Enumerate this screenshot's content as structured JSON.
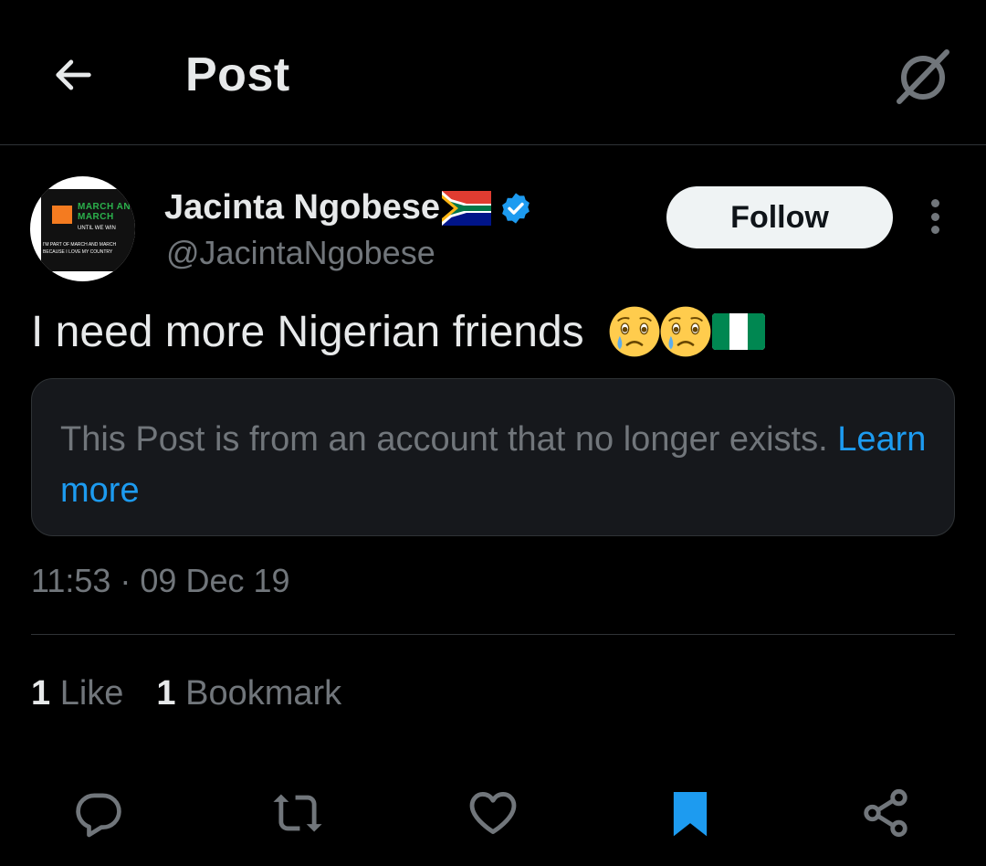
{
  "header": {
    "title": "Post",
    "back_icon": "arrow-left-icon",
    "grok_icon": "grok-icon"
  },
  "author": {
    "display_name": "Jacinta Ngobese",
    "flag_icon": "south-africa-flag-icon",
    "verified_icon": "verified-badge-icon",
    "handle": "@JacintaNgobese",
    "avatar": {
      "line1": "MARCH AND MARCH",
      "line2": "UNTIL WE WIN",
      "line3": "I'M PART OF MARCH AND MARCH",
      "line4": "BECAUSE I LOVE MY COUNTRY"
    }
  },
  "follow_label": "Follow",
  "more_icon": "more-vertical-icon",
  "post": {
    "text": "I need more Nigerian friends",
    "emojis": [
      "crying-face-emoji",
      "crying-face-emoji",
      "nigeria-flag-emoji"
    ]
  },
  "notice": {
    "text": "This Post is from an account that no longer exists.",
    "link": "Learn more"
  },
  "timestamp": "11:53 · 09 Dec 19",
  "stats": {
    "likes_count": "1",
    "likes_label": "Like",
    "bookmarks_count": "1",
    "bookmarks_label": "Bookmark"
  },
  "actions": {
    "reply_icon": "reply-icon",
    "repost_icon": "repost-icon",
    "like_icon": "like-icon",
    "bookmark_icon": "bookmark-icon",
    "share_icon": "share-icon"
  },
  "colors": {
    "background": "#000000",
    "text_primary": "#e7e9ea",
    "text_secondary": "#71767b",
    "accent_blue": "#1d9bf0",
    "border": "#2f3336"
  }
}
